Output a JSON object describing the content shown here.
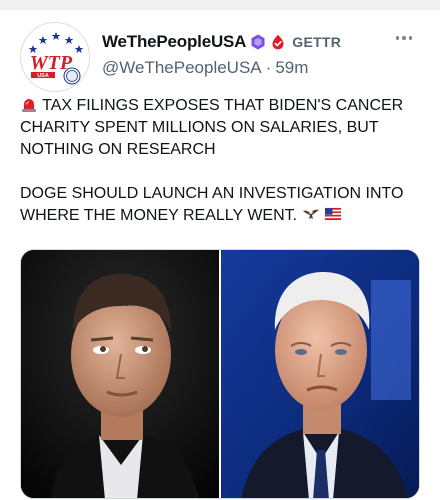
{
  "post": {
    "display_name": "WeThePeopleUSA",
    "platform": "GETTR",
    "handle": "@WeThePeopleUSA",
    "separator": "·",
    "time": "59m",
    "avatar_text": "WTP",
    "avatar_caption": "USA",
    "text_line1": "TAX FILINGS EXPOSES THAT BIDEN'S CANCER CHARITY SPENT MILLIONS ON SALARIES, BUT NOTHING ON RESEARCH",
    "text_line2": "DOGE SHOULD LAUNCH AN INVESTIGATION INTO WHERE THE MONEY REALLY WENT.",
    "icons": {
      "leading": "siren-icon",
      "trailing_1": "eagle-icon",
      "trailing_2": "us-flag-icon",
      "verified": "purple-verified-badge-icon",
      "platform": "gettr-logo-icon",
      "more": "more-options-icon"
    },
    "media": {
      "left_photo": "man-portrait-photo",
      "right_photo": "older-man-portrait-photo"
    }
  },
  "colors": {
    "accent_red": "#e11d2a",
    "verified_purple": "#7b4fe0",
    "muted_text": "#536471"
  }
}
